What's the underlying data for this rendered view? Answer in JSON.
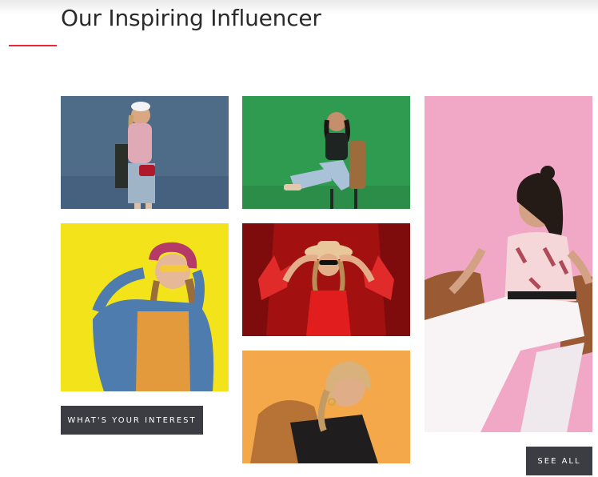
{
  "section": {
    "title": "Our Inspiring Influencer"
  },
  "gallery": {
    "photos": [
      {
        "subject": "woman in pink jacket with red bag against blue wall",
        "bg": "#4e6b88"
      },
      {
        "subject": "woman sitting on chair against green wall",
        "bg": "#2f9b50"
      },
      {
        "subject": "woman in pink top sitting in rattan chair",
        "bg": "#f1a8c6"
      },
      {
        "subject": "woman in denim jacket with sunglasses against yellow wall",
        "bg": "#f2e31a"
      },
      {
        "subject": "woman in red top and hat with maple leaf curtain",
        "bg": "#c01818"
      },
      {
        "subject": "woman in tan coat against orange background",
        "bg": "#f5a84a"
      }
    ]
  },
  "buttons": {
    "interest_label": "What's your interest",
    "see_all_label": "See all"
  },
  "colors": {
    "accent": "#e8283a",
    "button_bg": "#3b3d42"
  }
}
